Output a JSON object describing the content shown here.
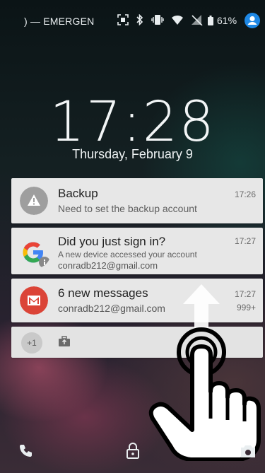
{
  "status_bar": {
    "carrier": ") — EMERGEN",
    "battery": "61%"
  },
  "clock": {
    "time": "17:28",
    "date": "Thursday, February 9"
  },
  "notifications": [
    {
      "title": "Backup",
      "text": "Need to set the backup account",
      "time": "17:26"
    },
    {
      "title": "Did you just sign in?",
      "text": "A new device accessed your account",
      "subtext": "conradb212@gmail.com",
      "time": "17:27"
    },
    {
      "title": "6 new messages",
      "text": "conradb212@gmail.com",
      "time": "17:27",
      "count": "999+"
    }
  ],
  "overflow": {
    "count": "+1"
  },
  "icons": {
    "status": [
      "screenshot-icon",
      "bluetooth-icon",
      "vibrate-icon",
      "wifi-icon",
      "no-signal-icon",
      "battery-icon",
      "account-icon"
    ],
    "backup": "warning-icon",
    "google": "google-icon",
    "gmail": "gmail-icon",
    "swipe": "swipe-up-arrow-icon",
    "hand": "pointing-hand-icon",
    "bottom": [
      "phone-icon",
      "lock-icon",
      "camera-icon"
    ]
  },
  "colors": {
    "gmail_red": "#db4437",
    "account_blue": "#1e88e5",
    "card_bg": "#e7e7e7"
  }
}
